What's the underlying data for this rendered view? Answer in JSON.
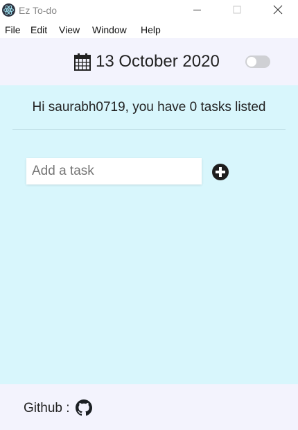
{
  "window": {
    "title": "Ez To-do"
  },
  "menu": {
    "items": [
      "File",
      "Edit",
      "View",
      "Window",
      "Help"
    ]
  },
  "header": {
    "date": "13 October 2020",
    "dark_mode_enabled": false
  },
  "main": {
    "greeting": "Hi saurabh0719, you have 0 tasks listed",
    "task_input": {
      "placeholder": "Add a task",
      "value": ""
    }
  },
  "footer": {
    "label": "Github :"
  },
  "colors": {
    "header_bg": "#f3f3fd",
    "main_bg": "#d8f6fc",
    "footer_bg": "#f3f3fd"
  },
  "icons": {
    "app": "electron-icon",
    "calendar": "calendar-icon",
    "add": "plus-circle-icon",
    "github": "github-icon"
  }
}
